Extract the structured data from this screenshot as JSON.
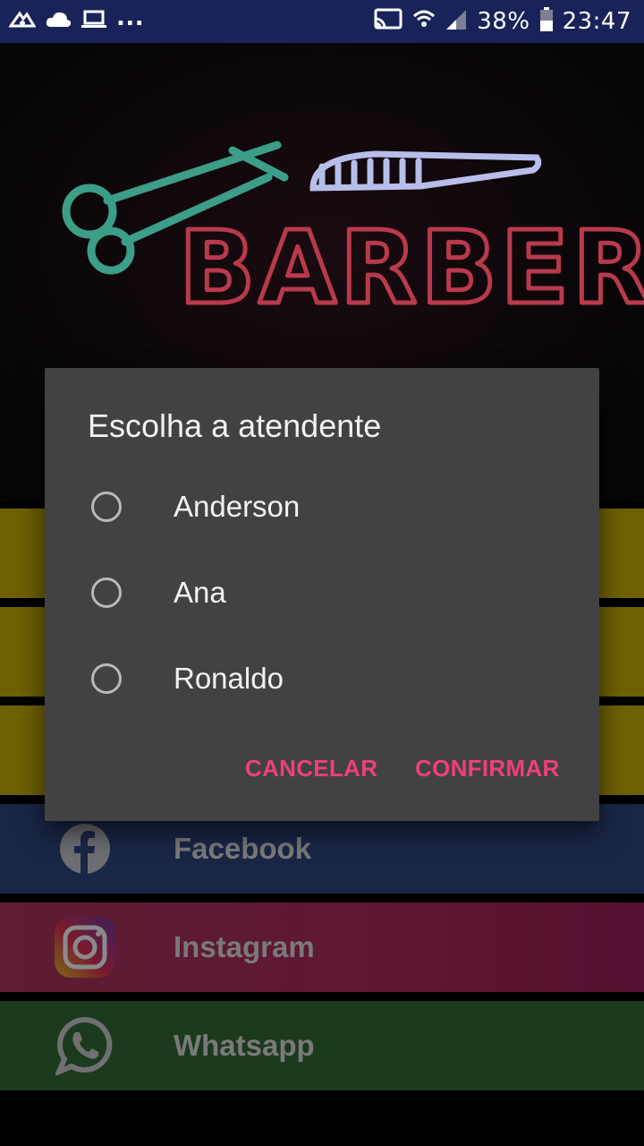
{
  "status_bar": {
    "battery": "38%",
    "time": "23:47",
    "overflow": "..."
  },
  "banner": {
    "sign_text": "BARBER"
  },
  "menu": {
    "items": [
      {
        "label": "Facebook",
        "icon": "facebook-icon"
      },
      {
        "label": "Instagram",
        "icon": "instagram-icon"
      },
      {
        "label": "Whatsapp",
        "icon": "whatsapp-icon"
      }
    ]
  },
  "dialog": {
    "title": "Escolha a atendente",
    "options": [
      {
        "label": "Anderson",
        "selected": false
      },
      {
        "label": "Ana",
        "selected": false
      },
      {
        "label": "Ronaldo",
        "selected": false
      }
    ],
    "cancel_label": "CANCELAR",
    "confirm_label": "CONFIRMAR"
  },
  "colors": {
    "accent": "#ef3f7a",
    "dialog_bg": "#424242",
    "status_bar": "#19235a"
  }
}
